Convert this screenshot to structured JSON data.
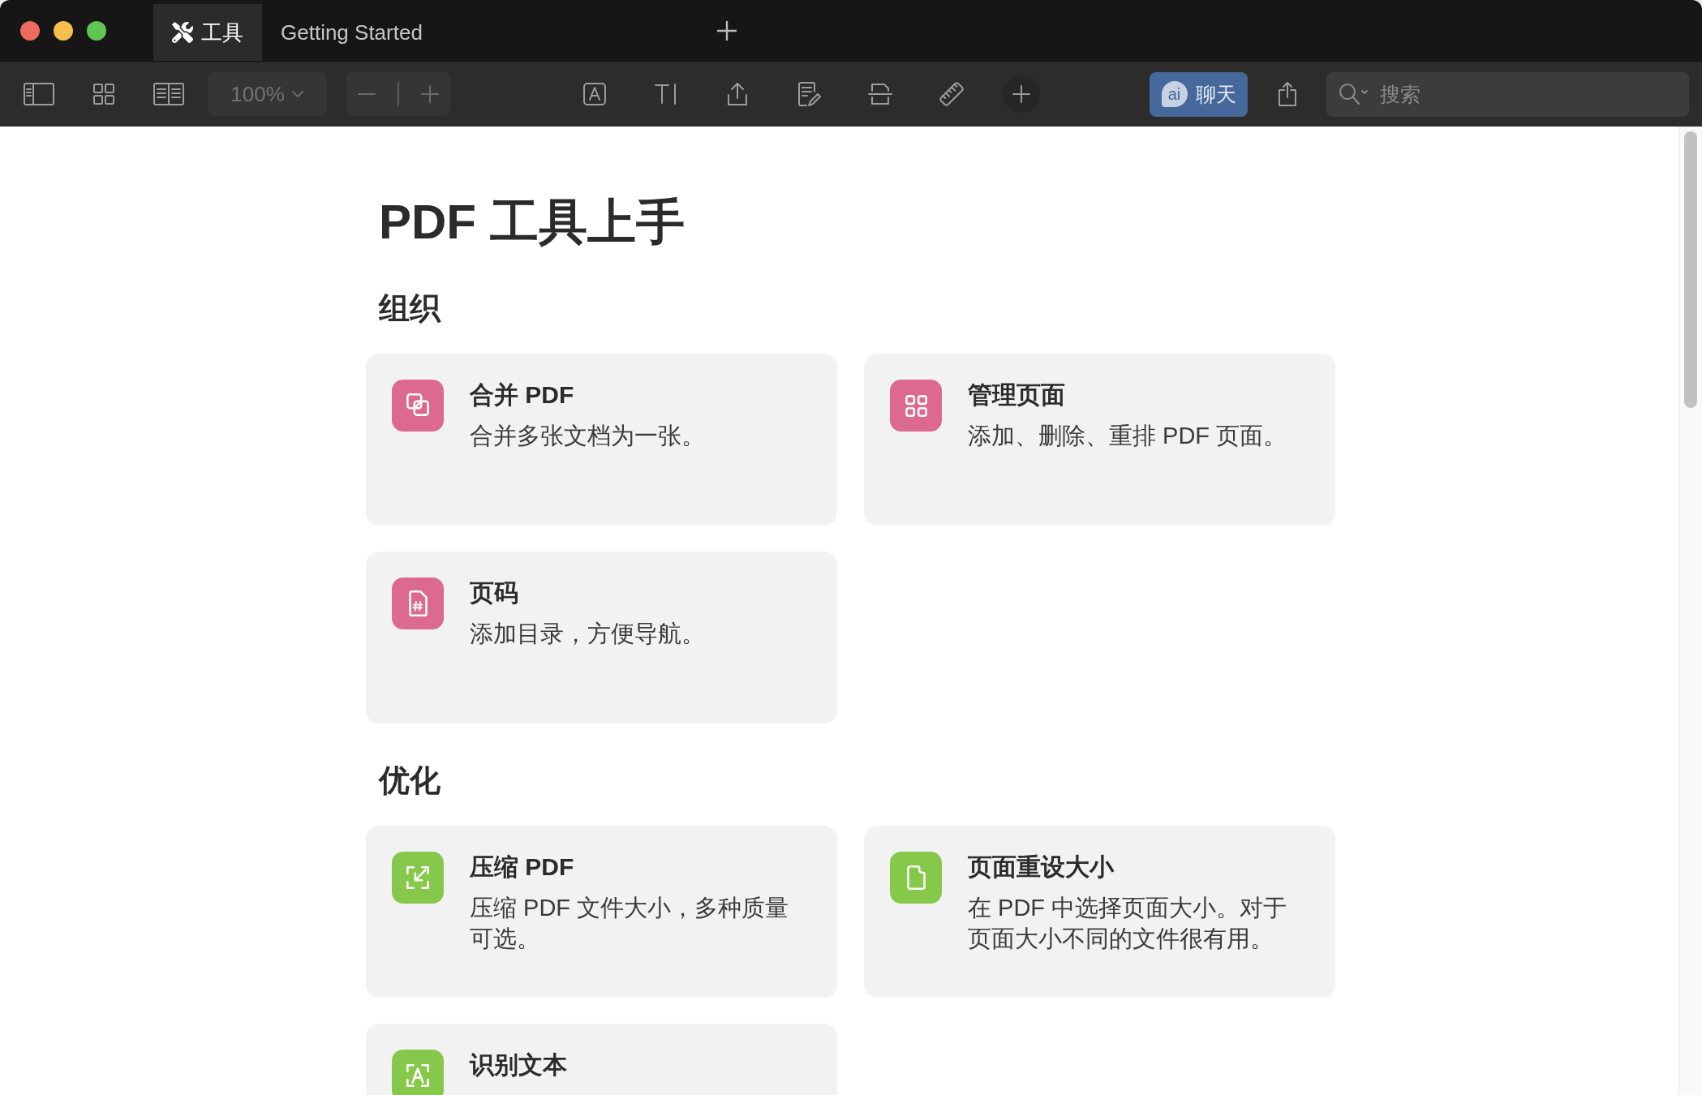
{
  "tabs": [
    {
      "kind": "tools",
      "label": "工具",
      "selected": true
    },
    {
      "kind": "document",
      "label": "Getting Started",
      "selected": false
    }
  ],
  "toolbar": {
    "zoom": {
      "value": "100%",
      "disabled": true
    },
    "chat_button": {
      "badge": "ai",
      "label": "聊天"
    },
    "search": {
      "placeholder": "搜索"
    }
  },
  "page": {
    "title": "PDF 工具上手",
    "sections": [
      {
        "heading": "组织",
        "tools": [
          {
            "kind": "merge",
            "title": "合并 PDF",
            "description": "合并多张文档为一张。",
            "color": "#dc6a8f"
          },
          {
            "kind": "pages",
            "title": "管理页面",
            "description": "添加、删除、重排 PDF 页面。",
            "color": "#dc6a8f"
          },
          {
            "kind": "page_number",
            "title": "页码",
            "description": "添加目录，方便导航。",
            "color": "#dc6a8f"
          }
        ]
      },
      {
        "heading": "优化",
        "tools": [
          {
            "kind": "compress",
            "title": "压缩 PDF",
            "description": "压缩 PDF 文件大小，多种质量可选。",
            "color": "#86c84a"
          },
          {
            "kind": "resize",
            "title": "页面重设大小",
            "description": "在 PDF 中选择页面大小。对于页面大小不同的文件很有用。",
            "color": "#86c84a"
          },
          {
            "kind": "ocr",
            "title": "识别文本",
            "color": "#86c84a"
          }
        ]
      }
    ]
  }
}
